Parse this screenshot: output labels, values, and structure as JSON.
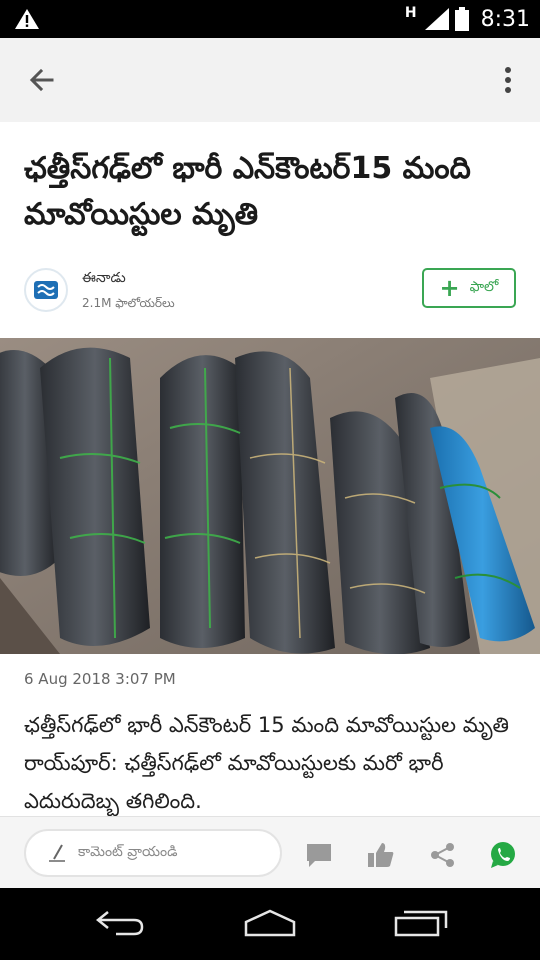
{
  "status_bar": {
    "signal_label": "H",
    "time": "8:31"
  },
  "article": {
    "title": "ఛత్తీస్‌గఢ్‌లో భారీ  ఎన్‌కౌంటర్‌15 మంది మావోయిస్టుల  మృతి",
    "publisher": {
      "name": "ఈనాడు",
      "followers": "2.1M ఫాలోయర్‌లు"
    },
    "follow_label": "ఫాలో",
    "date": "6 Aug 2018 3:07 PM",
    "body": "ఛత్తీస్‌గఢ్‌లో భారీ ఎన్‌కౌంటర్‌ 15 మంది మావోయిస్టుల మృతి రాయ్‌పూర్‌: ఛత్తీస్‌గఢ్‌లో మావోయిస్టులకు మరో భారీ ఎదురుదెబ్బ తగిలింది."
  },
  "action_bar": {
    "comment_placeholder": "కామెంట్ వ్రాయండి"
  },
  "colors": {
    "accent": "#3aa653",
    "whatsapp": "#25a944",
    "icon_gray": "#9a9a9a"
  }
}
